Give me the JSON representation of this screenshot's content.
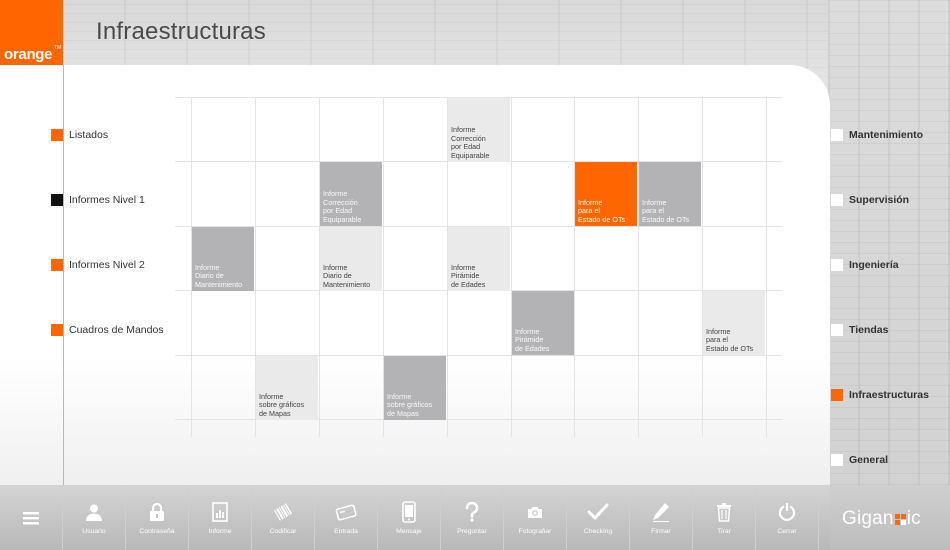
{
  "header": {
    "title": "Infraestructuras",
    "logo": "orange",
    "logo_mark": "TM"
  },
  "colors": {
    "accent": "#ff6600",
    "dark_tile": "#b3b3b5",
    "light_tile": "#eaeaea"
  },
  "left_nav": [
    {
      "label": "Listados",
      "color": "#ff6600"
    },
    {
      "label": "Informes Nivel 1",
      "color": "#111111"
    },
    {
      "label": "Informes Nivel 2",
      "color": "#ff6600"
    },
    {
      "label": "Cuadros de Mandos",
      "color": "#ff6600"
    }
  ],
  "right_nav": [
    {
      "label": "Mantenimiento",
      "active": false
    },
    {
      "label": "Supervisión",
      "active": false
    },
    {
      "label": "Ingeniería",
      "active": false
    },
    {
      "label": "Tiendas",
      "active": false
    },
    {
      "label": "Infraestructuras",
      "active": true
    },
    {
      "label": "General",
      "active": false
    }
  ],
  "tiles": [
    {
      "row": 0,
      "col": 4,
      "style": "light",
      "text": "Informe\nCorrección\npor Edad\nEquiparable"
    },
    {
      "row": 1,
      "col": 2,
      "style": "dark",
      "text": "Informe\nCorrección\npor Edad\nEquiparable"
    },
    {
      "row": 1,
      "col": 6,
      "style": "orange",
      "text": "Informe\npara el\nEstado de OTs"
    },
    {
      "row": 1,
      "col": 7,
      "style": "dark",
      "text": "Informe\npara el\nEstado de OTs"
    },
    {
      "row": 2,
      "col": 0,
      "style": "dark",
      "text": "Informe\nDiario de\nMantenimiento"
    },
    {
      "row": 2,
      "col": 2,
      "style": "light",
      "text": "Informe\nDiario de\nMantenimiento"
    },
    {
      "row": 2,
      "col": 4,
      "style": "light",
      "text": "Informe\nPirámide\nde Edades"
    },
    {
      "row": 3,
      "col": 5,
      "style": "dark",
      "text": "Informe\nPirámide\nde Edades"
    },
    {
      "row": 3,
      "col": 8,
      "style": "light",
      "text": "Informe\npara el\nEstado de OTs"
    },
    {
      "row": 4,
      "col": 1,
      "style": "light",
      "text": "Informe\nsobre gráficos\nde Mapas"
    },
    {
      "row": 4,
      "col": 3,
      "style": "dark",
      "text": "Informe\nsobre gráficos\nde Mapas"
    }
  ],
  "toolbar": [
    {
      "label": "",
      "icon": "menu-icon"
    },
    {
      "label": "Usuario",
      "icon": "user-icon"
    },
    {
      "label": "Contraseña",
      "icon": "lock-icon"
    },
    {
      "label": "Informe",
      "icon": "report-icon"
    },
    {
      "label": "Codificar",
      "icon": "barcode-icon"
    },
    {
      "label": "Entrada",
      "icon": "ticket-icon"
    },
    {
      "label": "Mensaje",
      "icon": "phone-icon"
    },
    {
      "label": "Preguntar",
      "icon": "question-icon"
    },
    {
      "label": "Fotografiar",
      "icon": "camera-icon"
    },
    {
      "label": "Checking",
      "icon": "check-icon"
    },
    {
      "label": "Firmar",
      "icon": "pen-icon"
    },
    {
      "label": "Tirar",
      "icon": "trash-icon"
    },
    {
      "label": "Cerrar",
      "icon": "power-icon"
    }
  ],
  "brand": {
    "text_before": "Gigan",
    "text_after": "ic"
  }
}
